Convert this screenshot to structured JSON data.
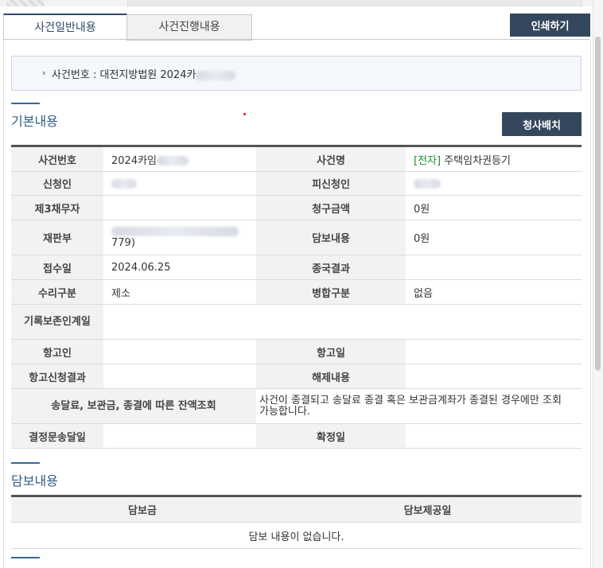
{
  "tabs": [
    {
      "label": "사건일반내용",
      "active": true
    },
    {
      "label": "사건진행내용",
      "active": false
    }
  ],
  "buttons": {
    "print": "인쇄하기",
    "assign": "청사배치"
  },
  "case_box": {
    "prefix": "사건번호 : 대전지방법원 2024카"
  },
  "sections": {
    "basic": "기본내용",
    "collateral": "담보내용"
  },
  "basic_info": {
    "case_no_label": "사건번호",
    "case_no_value": "2024카임",
    "case_name_label": "사건명",
    "case_name_tag": "[전자]",
    "case_name_value": "주택임차권등기",
    "applicant_label": "신청인",
    "respondent_label": "피신청인",
    "third_debtor_label": "제3채무자",
    "claim_amount_label": "청구금액",
    "claim_amount_value": "0원",
    "court_division_label": "재판부",
    "court_division_value_tail": "779)",
    "collateral_content_label": "담보내용",
    "collateral_content_value": "0원",
    "received_label": "접수일",
    "received_value": "2024.06.25",
    "final_result_label": "종국결과",
    "acceptance_type_label": "수리구분",
    "acceptance_type_value": "제소",
    "merge_type_label": "병합구분",
    "merge_type_value": "없음",
    "record_keeping_label": "기록보존인계일",
    "appellant_label": "항고인",
    "appeal_date_label": "항고일",
    "appeal_result_label": "항고신청결과",
    "release_label": "해제내용",
    "balance_label": "송달료, 보관금, 종결에 따른 잔액조회",
    "balance_note": "사건이 종결되고 송달료 종결 혹은 보관금계좌가 종결된 경우에만 조회 가능합니다.",
    "decision_delivery_label": "결정문송달일",
    "confirm_date_label": "확정일"
  },
  "collateral_table": {
    "headers": [
      "담보금",
      "담보제공일"
    ],
    "empty_message": "담보 내용이 없습니다."
  }
}
